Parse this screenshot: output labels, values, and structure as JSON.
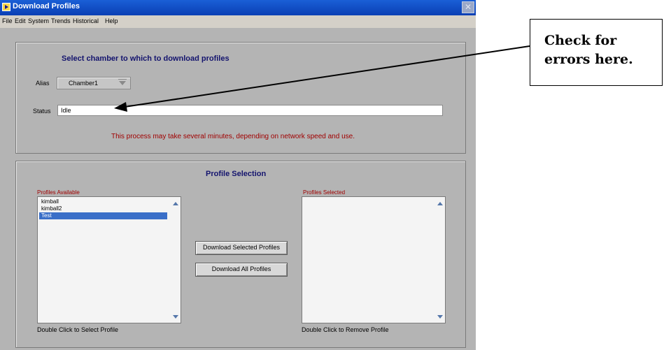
{
  "window": {
    "title": "Download Profiles"
  },
  "menu": [
    "File",
    "Edit",
    "System",
    "Trends",
    "Historical",
    "Help"
  ],
  "select_panel": {
    "heading": "Select chamber to which to download profiles",
    "alias_label": "Alias",
    "alias_value": "Chamber1",
    "status_label": "Status",
    "status_value": "Idle",
    "warning": "This process may take several minutes, depending on network speed and use."
  },
  "profile_panel": {
    "heading": "Profile Selection",
    "available_label": "Profiles Available",
    "available_items": [
      "kimball",
      "kimball2",
      "Test"
    ],
    "selected_item": "Test",
    "selected_label": "Profiles Selected",
    "selected_items": [],
    "available_hint": "Double Click to Select Profile",
    "selected_hint": "Double Click to Remove Profile",
    "download_selected_label": "Download Selected Profiles",
    "download_all_label": "Download All Profiles"
  },
  "callout": {
    "line1": "Check for",
    "line2": "errors here."
  },
  "colors": {
    "titlebar": "#0a3fb4",
    "heading": "#14146e",
    "warning": "#a00000",
    "selection": "#3a6fc8"
  }
}
